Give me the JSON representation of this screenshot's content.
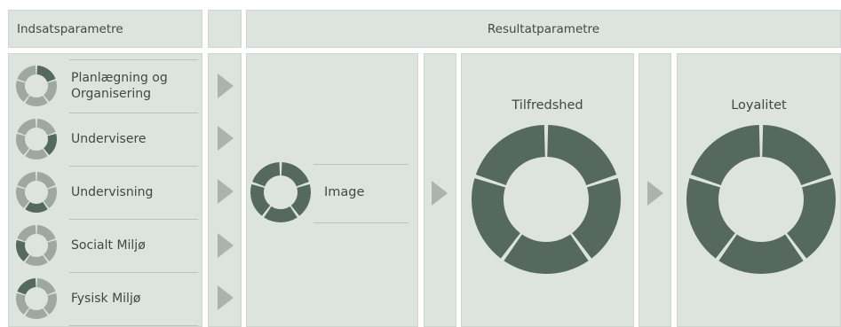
{
  "headers": {
    "input": "Indsatsparametre",
    "result": "Resultatparametre"
  },
  "input_items": [
    {
      "label": "Planlægning og Organisering",
      "highlight": 0
    },
    {
      "label": "Undervisere",
      "highlight": 1
    },
    {
      "label": "Undervisning",
      "highlight": 2
    },
    {
      "label": "Socialt Miljø",
      "highlight": 3
    },
    {
      "label": "Fysisk Miljø",
      "highlight": 4
    }
  ],
  "image_node": {
    "label": "Image"
  },
  "outputs": [
    {
      "title": "Tilfredshed"
    },
    {
      "title": "Loyalitet"
    }
  ],
  "colors": {
    "dark": "#56695e",
    "light": "#9ea8a0",
    "panel": "#dde3de",
    "arrow": "#aab4ac"
  }
}
